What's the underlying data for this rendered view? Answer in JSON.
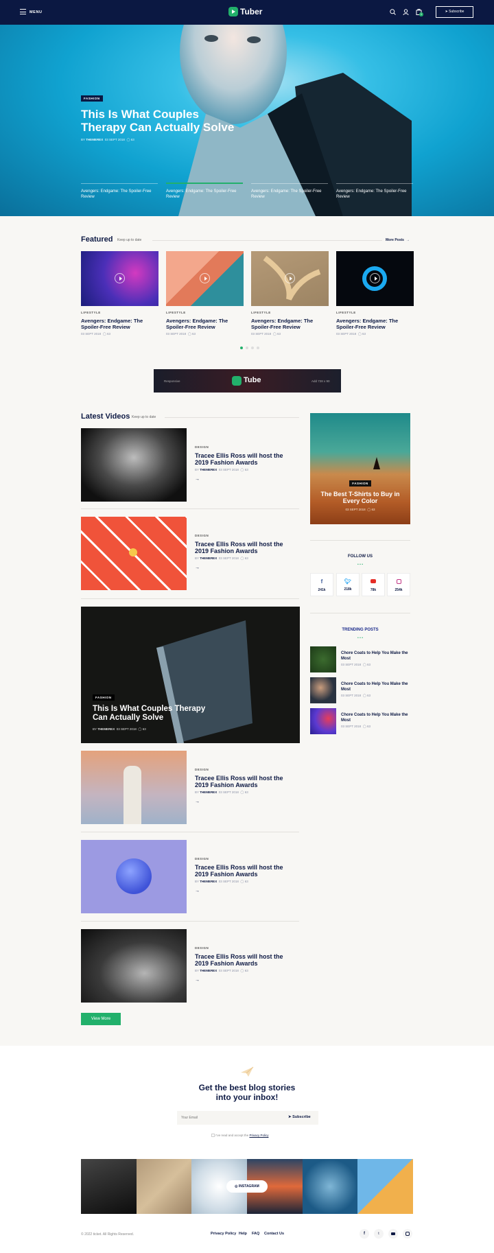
{
  "header": {
    "menu_label": "MENU",
    "logo_text": "Tuber",
    "subscribe_label": "Subscribe",
    "cart_count": "0"
  },
  "hero": {
    "category": "FASHION",
    "title": "This Is What Couples Therapy Can Actually Solve",
    "author_prefix": "BY",
    "author": "THEMEREX",
    "date": "03 SEPT 2018",
    "comments": "63",
    "tabs": [
      "Avengers: Endgame: The Spoiler-Free Review",
      "Avengers: Endgame: The Spoiler-Free Review",
      "Avengers: Endgame: The Spoiler-Free Review",
      "Avengers: Endgame: The Spoiler-Free Review"
    ]
  },
  "featured": {
    "title": "Featured",
    "subtitle": "Keep up to date",
    "more_label": "More Posts",
    "items": [
      {
        "category": "LIFESTYLE",
        "title": "Avengers: Endgame: The Spoiler-Free Review",
        "date": "03 SEPT 2018",
        "comments": "63"
      },
      {
        "category": "LIFESTYLE",
        "title": "Avengers: Endgame: The Spoiler-Free Review",
        "date": "03 SEPT 2018",
        "comments": "63"
      },
      {
        "category": "LIFESTYLE",
        "title": "Avengers: Endgame: The Spoiler-Free Review",
        "date": "03 SEPT 2018",
        "comments": "63"
      },
      {
        "category": "LIFESTYLE",
        "title": "Avengers: Endgame: The Spoiler-Free Review",
        "date": "03 SEPT 2018",
        "comments": "63"
      }
    ]
  },
  "ad": {
    "left": "Responsive",
    "logo": "Tube",
    "right": "Add 728 x 90"
  },
  "latest": {
    "title": "Latest Videos",
    "subtitle": "Keep up to date",
    "items": [
      {
        "category": "DESIGN",
        "title": "Tracee Ellis Ross will host the 2019 Fashion Awards",
        "author_prefix": "BY",
        "author": "THEMEREX",
        "date": "03 SEPT 2018",
        "comments": "63"
      },
      {
        "category": "DESIGN",
        "title": "Tracee Ellis Ross will host the 2019 Fashion Awards",
        "author_prefix": "BY",
        "author": "THEMEREX",
        "date": "03 SEPT 2018",
        "comments": "63"
      },
      {
        "category": "DESIGN",
        "title": "Tracee Ellis Ross will host the 2019 Fashion Awards",
        "author_prefix": "BY",
        "author": "THEMEREX",
        "date": "03 SEPT 2018",
        "comments": "63"
      },
      {
        "category": "DESIGN",
        "title": "Tracee Ellis Ross will host the 2019 Fashion Awards",
        "author_prefix": "BY",
        "author": "THEMEREX",
        "date": "03 SEPT 2018",
        "comments": "63"
      },
      {
        "category": "DESIGN",
        "title": "Tracee Ellis Ross will host the 2019 Fashion Awards",
        "author_prefix": "BY",
        "author": "THEMEREX",
        "date": "03 SEPT 2018",
        "comments": "63"
      }
    ],
    "big": {
      "category": "FASHION",
      "title": "This Is What Couples Therapy Can Actually Solve",
      "author_prefix": "BY",
      "author": "THEMEREX",
      "date": "03 SEPT 2018",
      "comments": "63"
    },
    "view_more": "View More"
  },
  "sidebar": {
    "promo": {
      "category": "FASHION",
      "title": "The Best T-Shirts to Buy in Every Color",
      "date": "03 SEPT 2018",
      "comments": "63"
    },
    "follow_title": "FOLLOW US",
    "social": [
      {
        "icon": "facebook-icon",
        "count": "241k"
      },
      {
        "icon": "twitter-icon",
        "count": "218k"
      },
      {
        "icon": "youtube-icon",
        "count": "78k"
      },
      {
        "icon": "instagram-icon",
        "count": "254k"
      }
    ],
    "trending_title": "TRENDING POSTS",
    "trending": [
      {
        "title": "Chore Coats to Help You Make the Most",
        "date": "03 SEPT 2018",
        "comments": "63"
      },
      {
        "title": "Chore Coats to Help You Make the Most",
        "date": "03 SEPT 2018",
        "comments": "63"
      },
      {
        "title": "Chore Coats to Help You Make the Most",
        "date": "03 SEPT 2018",
        "comments": "63"
      }
    ]
  },
  "newsletter": {
    "title": "Get the best blog stories into your inbox!",
    "placeholder": "Your Email",
    "button": "Subscribe",
    "consent": "I've read and accept the",
    "policy": "Privacy Policy"
  },
  "instagram": {
    "label": "INSTAGRAM"
  },
  "footer": {
    "copyright": "© 2022 ticket. All Rights Reserved.",
    "links": [
      "Privacy Policy",
      "Help",
      "FAQ",
      "Contact Us"
    ]
  },
  "colors": {
    "navy": "#0b1842",
    "green": "#22b06b",
    "hero_blue": "#10a2d0"
  }
}
